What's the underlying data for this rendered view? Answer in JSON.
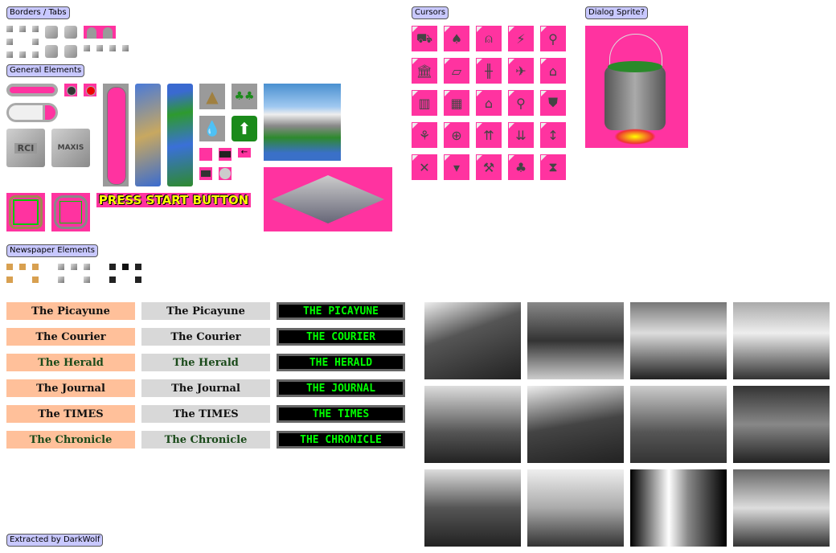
{
  "sections": {
    "borders": "Borders / Tabs",
    "general": "General Elements",
    "newspaper": "Newspaper Elements",
    "cursors": "Cursors",
    "dialog": "Dialog Sprite?",
    "credit": "Extracted by DarkWolf"
  },
  "general": {
    "rci": "RCI",
    "maxis": "MAXIS",
    "press_start": "PRESS START BUTTON"
  },
  "cursors": [
    "bulldozer",
    "tree",
    "siren",
    "lightning",
    "faucet",
    "government",
    "road",
    "rail",
    "airport",
    "house",
    "office",
    "factory",
    "residential",
    "magnifier",
    "police",
    "balloons",
    "target",
    "arrows-up",
    "arrows-down",
    "up-down",
    "expand",
    "drop",
    "tool",
    "trees",
    "hourglass"
  ],
  "newspapers": [
    "The Picayune",
    "The Courier",
    "The Herald",
    "The Journal",
    "The TIMES",
    "The Chronicle"
  ],
  "newspapers_led": [
    "THE PICAYUNE",
    "THE COURIER",
    "THE HERALD",
    "THE JOURNAL",
    "THE TIMES",
    "THE CHRONICLE"
  ],
  "colors": {
    "transparent_key": "#ff33a0",
    "label_bg": "#c8c8ff",
    "led_text": "#00ff00",
    "peach": "#ffc09a"
  }
}
